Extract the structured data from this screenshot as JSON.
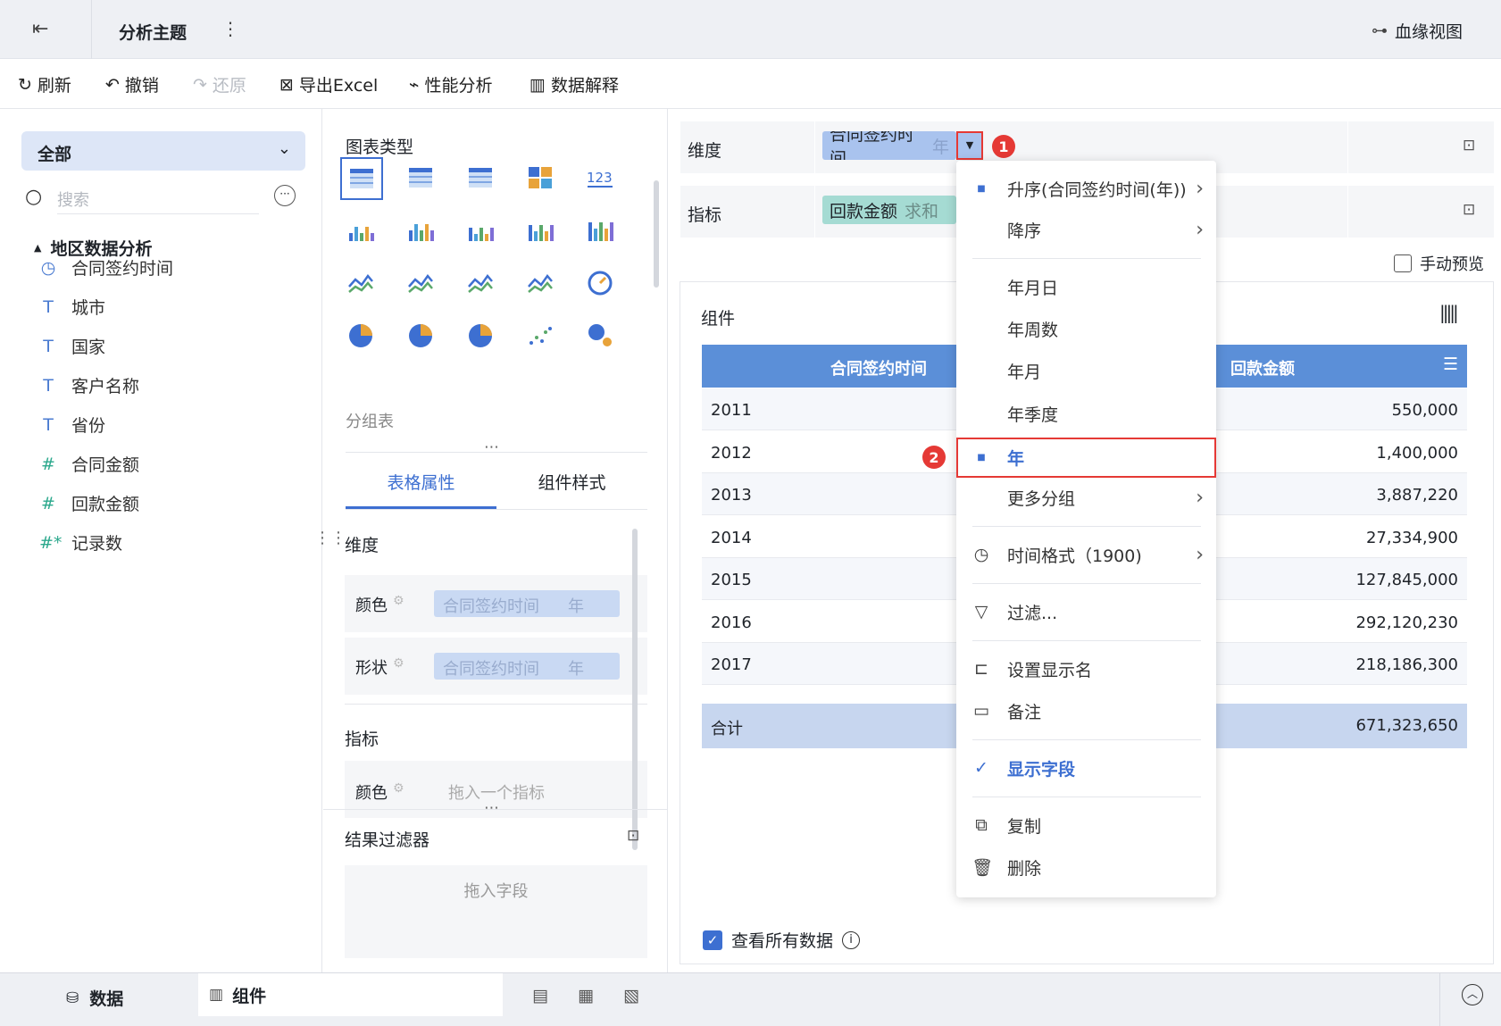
{
  "topbar": {
    "title": "分析主题",
    "lineage": "血缘视图"
  },
  "toolbar": {
    "refresh": "刷新",
    "undo": "撤销",
    "redo": "还原",
    "export": "导出Excel",
    "perf": "性能分析",
    "explain": "数据解释"
  },
  "left": {
    "dataset": "全部",
    "search_placeholder": "搜索",
    "group": "地区数据分析",
    "fields": [
      {
        "icon": "clock",
        "label": "合同签约时间"
      },
      {
        "icon": "T",
        "label": "城市"
      },
      {
        "icon": "T",
        "label": "国家"
      },
      {
        "icon": "T",
        "label": "客户名称"
      },
      {
        "icon": "T",
        "label": "省份"
      },
      {
        "icon": "#",
        "label": "合同金额"
      },
      {
        "icon": "#",
        "label": "回款金额"
      },
      {
        "icon": "#*",
        "label": "记录数"
      }
    ]
  },
  "mid": {
    "chart_type_title": "图表类型",
    "chart_type_name": "分组表",
    "tabs": [
      "表格属性",
      "组件样式"
    ],
    "dimension_label": "维度",
    "color_label": "颜色",
    "shape_label": "形状",
    "field_name": "合同签约时间",
    "field_unit": "年",
    "metric_label": "指标",
    "metric_color_label": "颜色",
    "metric_placeholder": "拖入一个指标",
    "result_filter": "结果过滤器",
    "drop_field": "拖入字段"
  },
  "right": {
    "dimension_label": "维度",
    "dimension_pill": "合同签约时间",
    "dimension_unit": "年",
    "metric_label": "指标",
    "metric_pill": "回款金额",
    "metric_agg": "求和",
    "manual_preview": "手动预览",
    "component_title": "组件",
    "table": {
      "headers": [
        "合同签约时间",
        "回款金额"
      ],
      "rows": [
        {
          "year": "2011",
          "value": "550,000"
        },
        {
          "year": "2012",
          "value": "1,400,000"
        },
        {
          "year": "2013",
          "value": "3,887,220"
        },
        {
          "year": "2014",
          "value": "27,334,900"
        },
        {
          "year": "2015",
          "value": "127,845,000"
        },
        {
          "year": "2016",
          "value": "292,120,230"
        },
        {
          "year": "2017",
          "value": "218,186,300"
        }
      ],
      "total_label": "合计",
      "total_value": "671,323,650"
    },
    "view_all": "查看所有数据"
  },
  "menu": {
    "asc": "升序(合同签约时间(年))",
    "desc": "降序",
    "ymd": "年月日",
    "yw": "年周数",
    "ym": "年月",
    "yq": "年季度",
    "y": "年",
    "more": "更多分组",
    "timefmt": "时间格式（1900)",
    "filter": "过滤...",
    "alias": "设置显示名",
    "note": "备注",
    "show": "显示字段",
    "copy": "复制",
    "delete": "删除"
  },
  "badges": {
    "one": "1",
    "two": "2"
  },
  "bottom": {
    "data": "数据",
    "component": "组件"
  },
  "colors": {
    "accent": "#3d6fd1",
    "header": "#5b8fd8",
    "pill": "#a9c3ee",
    "highlight": "#e53935"
  }
}
